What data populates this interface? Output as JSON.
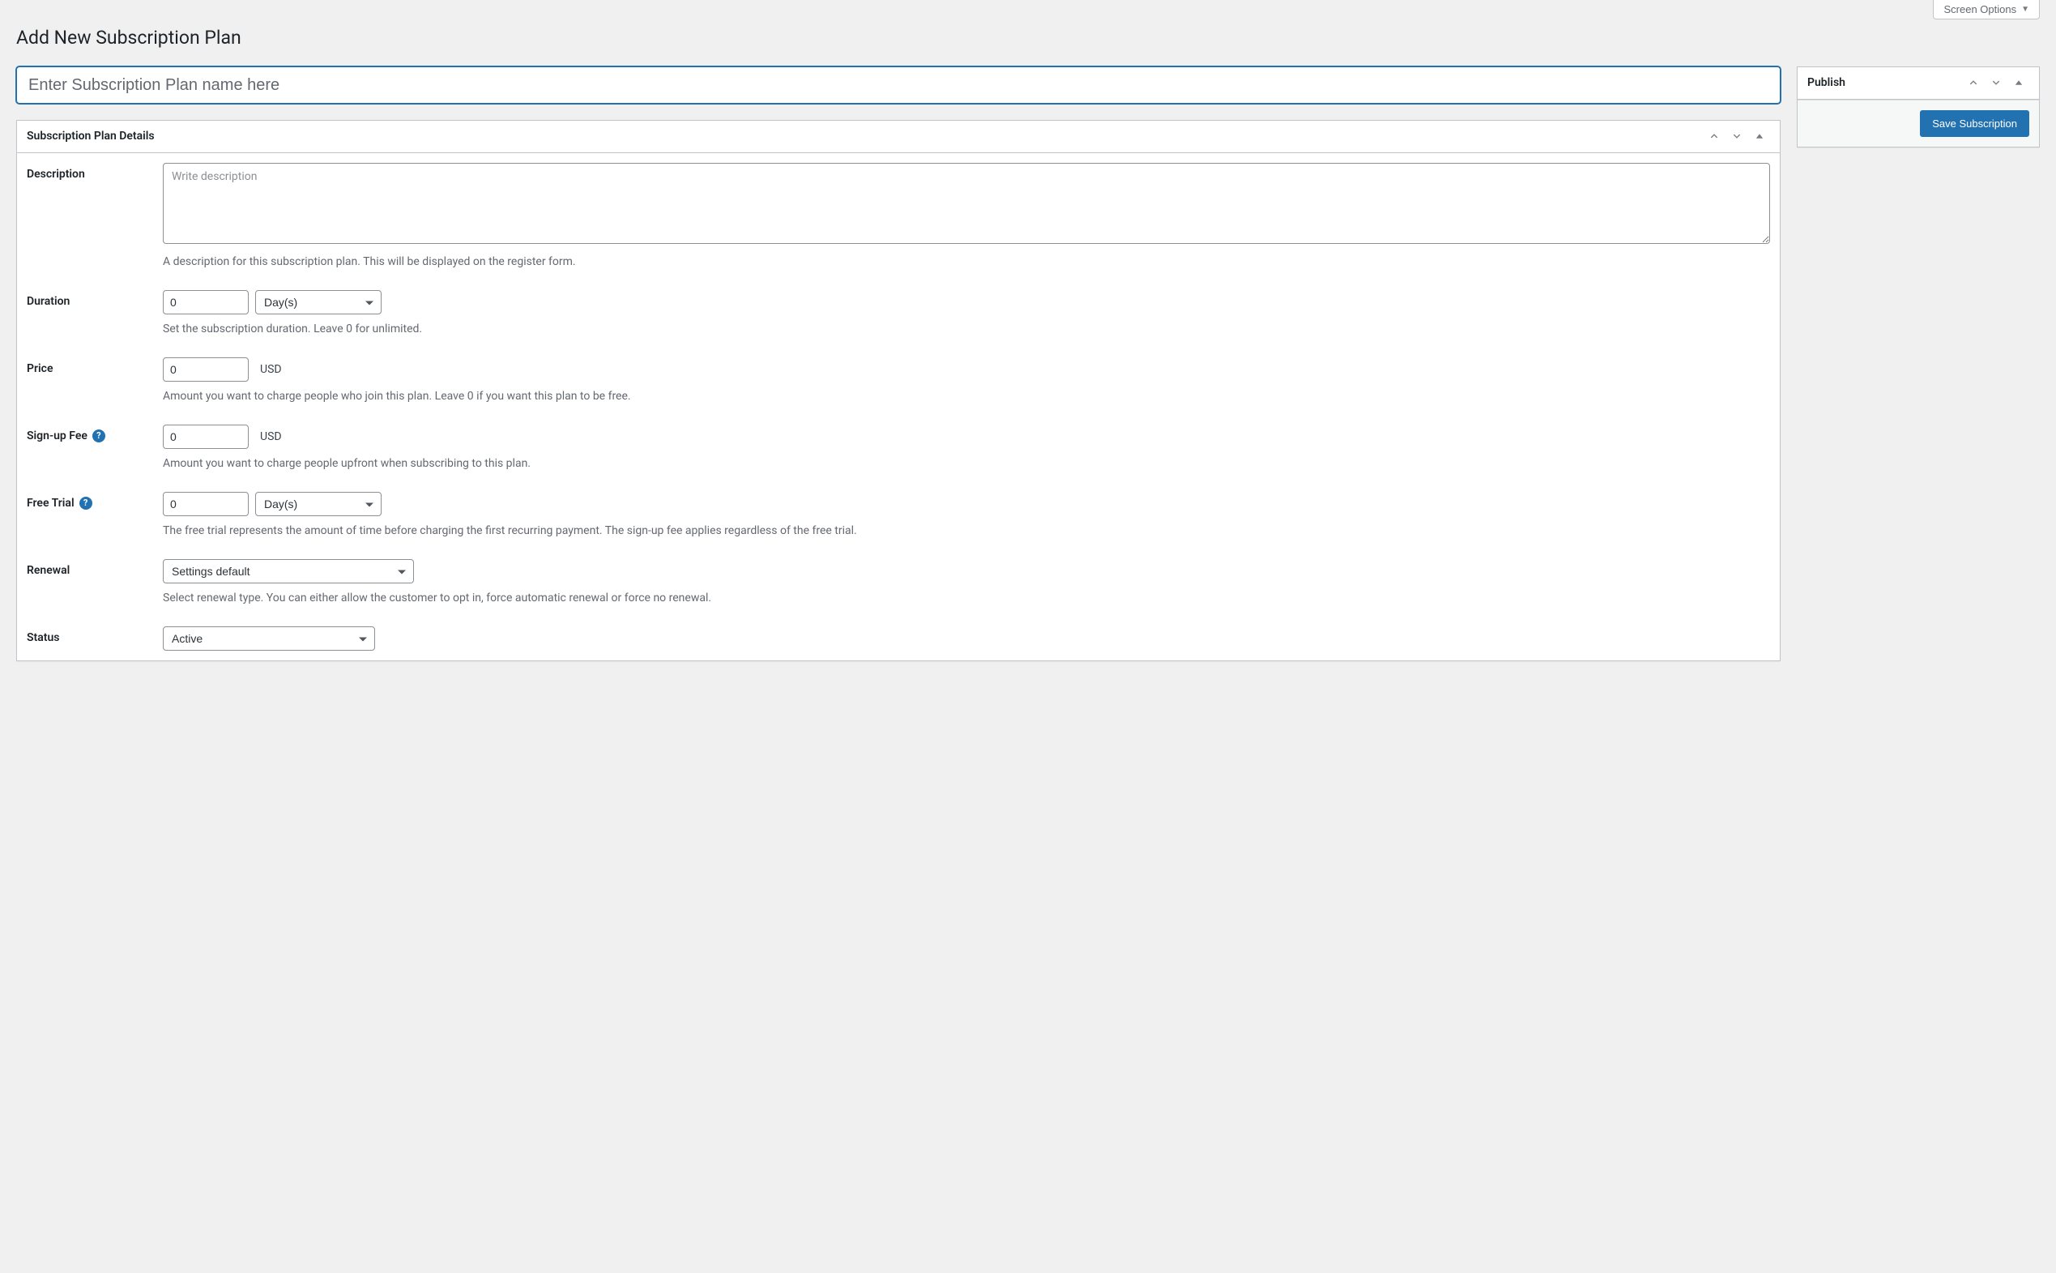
{
  "screen_options_label": "Screen Options",
  "page_title": "Add New Subscription Plan",
  "title_placeholder": "Enter Subscription Plan name here",
  "title_value": "",
  "details_panel_title": "Subscription Plan Details",
  "publish_panel_title": "Publish",
  "save_button_label": "Save Subscription",
  "fields": {
    "description": {
      "label": "Description",
      "placeholder": "Write description",
      "value": "",
      "help": "A description for this subscription plan. This will be displayed on the register form."
    },
    "duration": {
      "label": "Duration",
      "value": "0",
      "unit_selected": "Day(s)",
      "help": "Set the subscription duration. Leave 0 for unlimited."
    },
    "price": {
      "label": "Price",
      "value": "0",
      "currency": "USD",
      "help": "Amount you want to charge people who join this plan. Leave 0 if you want this plan to be free."
    },
    "signup_fee": {
      "label": "Sign-up Fee",
      "value": "0",
      "currency": "USD",
      "help": "Amount you want to charge people upfront when subscribing to this plan."
    },
    "free_trial": {
      "label": "Free Trial",
      "value": "0",
      "unit_selected": "Day(s)",
      "help": "The free trial represents the amount of time before charging the first recurring payment. The sign-up fee applies regardless of the free trial."
    },
    "renewal": {
      "label": "Renewal",
      "selected": "Settings default",
      "help": "Select renewal type. You can either allow the customer to opt in, force automatic renewal or force no renewal."
    },
    "status": {
      "label": "Status",
      "selected": "Active"
    }
  }
}
